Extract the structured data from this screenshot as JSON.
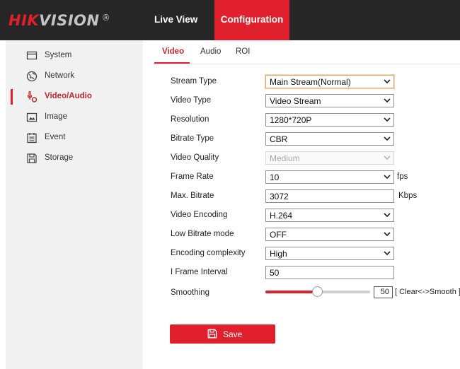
{
  "brand": {
    "logo_red": "HIK",
    "logo_gray": "VISION",
    "logo_mark": "®"
  },
  "nav": {
    "live_view": "Live View",
    "configuration": "Configuration",
    "active": "configuration"
  },
  "sidebar": {
    "items": [
      {
        "label": "System",
        "icon": "monitor-icon"
      },
      {
        "label": "Network",
        "icon": "globe-icon"
      },
      {
        "label": "Video/Audio",
        "icon": "video-audio-icon",
        "active": true
      },
      {
        "label": "Image",
        "icon": "image-icon"
      },
      {
        "label": "Event",
        "icon": "calendar-icon"
      },
      {
        "label": "Storage",
        "icon": "storage-icon"
      }
    ]
  },
  "tabs": {
    "video": "Video",
    "audio": "Audio",
    "roi": "ROI",
    "active": "video"
  },
  "form": {
    "stream_type": {
      "label": "Stream Type",
      "value": "Main Stream(Normal)"
    },
    "video_type": {
      "label": "Video Type",
      "value": "Video Stream"
    },
    "resolution": {
      "label": "Resolution",
      "value": "1280*720P"
    },
    "bitrate_type": {
      "label": "Bitrate Type",
      "value": "CBR"
    },
    "video_quality": {
      "label": "Video Quality",
      "value": "Medium",
      "disabled": true
    },
    "frame_rate": {
      "label": "Frame Rate",
      "value": "10",
      "unit": "fps"
    },
    "max_bitrate": {
      "label": "Max. Bitrate",
      "value": "3072",
      "unit": "Kbps"
    },
    "video_encoding": {
      "label": "Video Encoding",
      "value": "H.264"
    },
    "low_bitrate_mode": {
      "label": "Low Bitrate mode",
      "value": "OFF"
    },
    "encoding_complexity": {
      "label": "Encoding complexity",
      "value": "High"
    },
    "i_frame_interval": {
      "label": "I Frame Interval",
      "value": "50"
    },
    "smoothing": {
      "label": "Smoothing",
      "value": "50",
      "hint": "[ Clear<->Smooth ]",
      "level_percent": 50
    }
  },
  "save": {
    "label": "Save"
  },
  "colors": {
    "accent": "#e0202c",
    "header_bg": "#262626",
    "sidebar_bg": "#f1f1f1"
  }
}
